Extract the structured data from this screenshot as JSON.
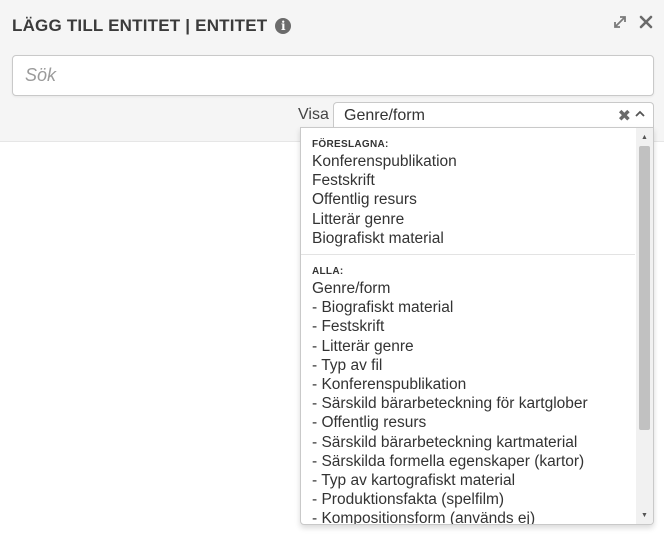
{
  "header": {
    "title": "LÄGG TILL ENTITET | ENTITET",
    "info_icon": "i"
  },
  "search": {
    "placeholder": "Sök",
    "value": ""
  },
  "filter": {
    "label": "Visa",
    "selected": "Genre/form",
    "clear_glyph": "✖"
  },
  "dropdown": {
    "suggested": {
      "header": "FÖRESLAGNA:",
      "items": [
        "Konferenspublikation",
        "Festskrift",
        "Offentlig resurs",
        "Litterär genre",
        "Biografiskt material"
      ]
    },
    "all": {
      "header": "ALLA:",
      "items": [
        "Genre/form",
        "- Biografiskt material",
        "- Festskrift",
        "- Litterär genre",
        "- Typ av fil",
        "- Konferenspublikation",
        "- Särskild bärarbeteckning för kartglober",
        "- Offentlig resurs",
        "- Särskild bärarbeteckning kartmaterial",
        "- Särskilda formella egenskaper (kartor)",
        "- Typ av kartografiskt material",
        "- Produktionsfakta (spelfilm)",
        "- Kompositionsform (används ej)"
      ]
    }
  },
  "colors": {
    "header_background": "#f5f5f5",
    "text": "#333333",
    "scroll_thumb": "#c1c1c1"
  }
}
